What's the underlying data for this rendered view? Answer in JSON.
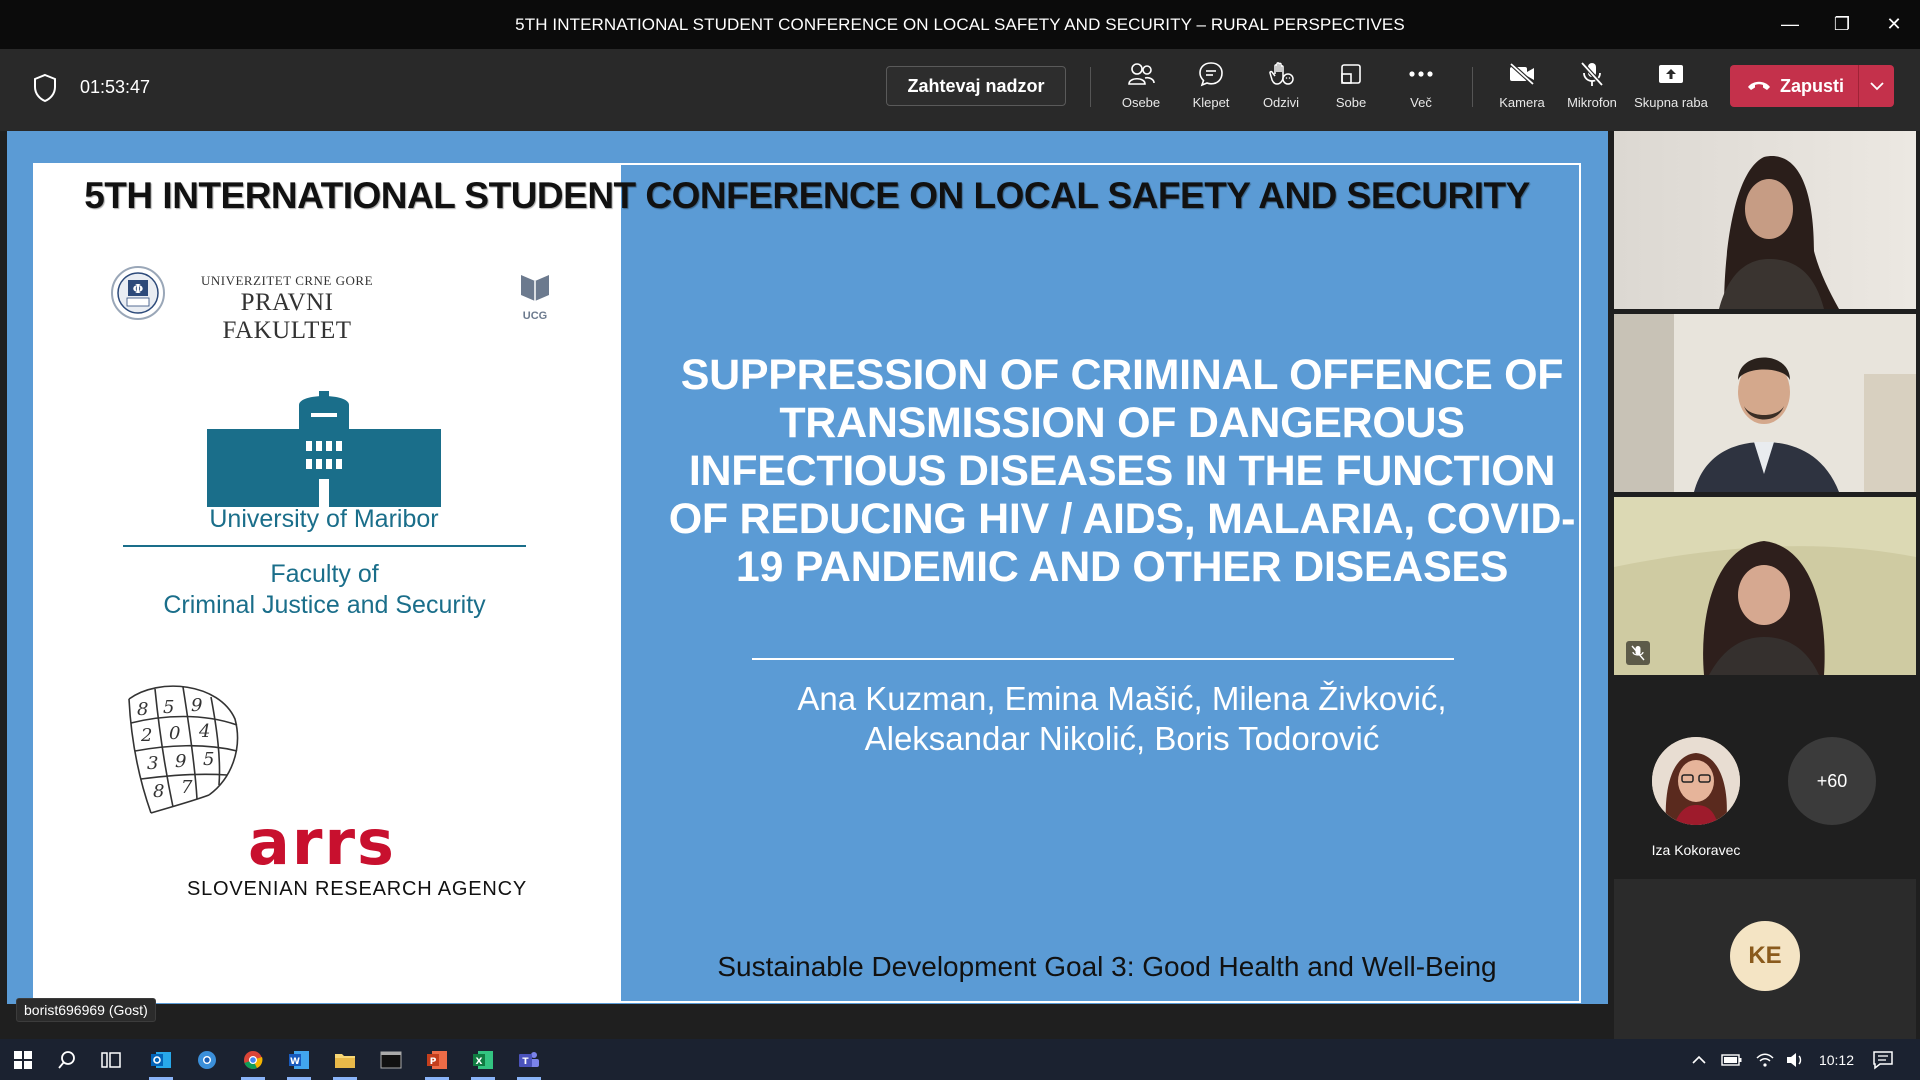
{
  "window": {
    "title": "5TH INTERNATIONAL STUDENT CONFERENCE ON LOCAL SAFETY AND SECURITY – RURAL PERSPECTIVES",
    "minimize": "—",
    "restore": "❐",
    "close": "✕"
  },
  "toolbar": {
    "timer": "01:53:47",
    "request_control": "Zahtevaj nadzor",
    "people": "Osebe",
    "chat": "Klepet",
    "reactions": "Odzivi",
    "rooms": "Sobe",
    "more": "Več",
    "camera": "Kamera",
    "mic": "Mikrofon",
    "share": "Skupna raba",
    "leave": "Zapusti",
    "leave_color": "#c4314b"
  },
  "slide": {
    "conference_title": "5TH INTERNATIONAL STUDENT CONFERENCE ON LOCAL SAFETY AND SECURITY",
    "main_title": "SUPPRESSION OF CRIMINAL OFFENCE OF TRANSMISSION OF DANGEROUS INFECTIOUS DISEASES IN THE FUNCTION OF REDUCING HIV / AIDS, MALARIA, COVID-19 PANDEMIC AND OTHER DISEASES",
    "authors_line1": "Ana Kuzman, Emina Mašić, Milena Živković,",
    "authors_line2": "Aleksandar Nikolić, Boris Todorović",
    "sdg": "Sustainable Development Goal 3: Good Health and Well-Being",
    "background_color": "#5b9bd5",
    "logos": {
      "ucg_university": "UNIVERZITET CRNE GORE",
      "ucg_faculty": "PRAVNI FAKULTET",
      "ucg_mark": "UCG",
      "um_name": "University of Maribor",
      "um_faculty_line1": "Faculty of",
      "um_faculty_line2": "Criminal Justice and Security",
      "arrs_word": "arrs",
      "arrs_agency": "SLOVENIAN RESEARCH AGENCY"
    }
  },
  "presenter_tag": "borist696969 (Gost)",
  "participants": {
    "avatar_name": "Iza Kokoravec",
    "more_count": "+60",
    "initials": "KE"
  },
  "taskbar": {
    "clock": "10:12"
  }
}
